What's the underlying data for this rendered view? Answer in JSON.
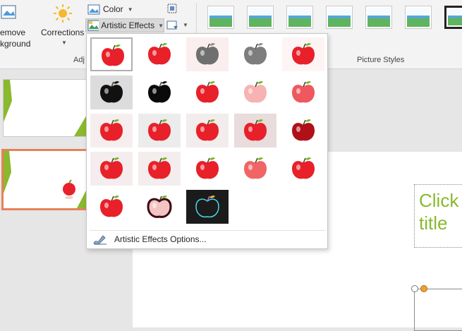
{
  "ribbon": {
    "remove_bg_line1": "emove",
    "remove_bg_line2": "kground",
    "corrections_label": "Corrections",
    "color_label": "Color",
    "artistic_effects_label": "Artistic Effects",
    "adjust_group_label": "Adj",
    "picture_styles_label": "Picture Styles"
  },
  "slide": {
    "title_placeholder": "Click\ntitle"
  },
  "gallery": {
    "options_label": "Artistic Effects Options...",
    "effects": [
      "none",
      "marker",
      "pencil-grayscale",
      "pencil-sketch",
      "line-drawing",
      "chalk-sketch",
      "paint-strokes",
      "paint-brush",
      "glow-diffused",
      "blur",
      "light-screen",
      "watercolor-sponge",
      "film-grain",
      "mosaic-bubbles",
      "glass",
      "cement",
      "texturizer",
      "crisscross-etching",
      "pastels-smooth",
      "plastic-wrap",
      "cutout",
      "photocopy",
      "glow-edges"
    ]
  },
  "colors": {
    "accent_green": "#8ab82e",
    "selected_slide_border": "#e8805a",
    "apple_red": "#e8202a"
  }
}
